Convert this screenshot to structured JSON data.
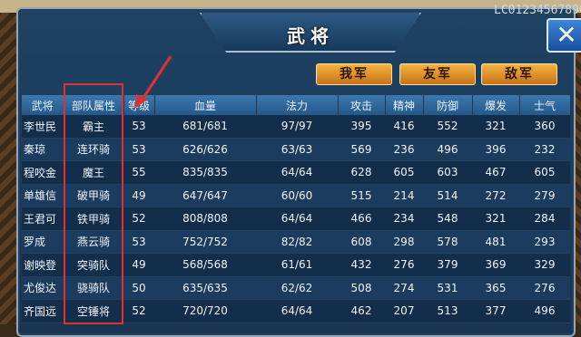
{
  "window": {
    "title": "武将",
    "id_text": "LC01234567890",
    "close_label": "✕"
  },
  "tabs": [
    {
      "label": "我军"
    },
    {
      "label": "友军"
    },
    {
      "label": "敌军"
    }
  ],
  "table": {
    "headers": [
      "武将",
      "部队属性",
      "等级",
      "血量",
      "法力",
      "攻击",
      "精神",
      "防御",
      "爆发",
      "士气"
    ],
    "rows": [
      [
        "李世民",
        "霸主",
        "53",
        "681/681",
        "97/97",
        "395",
        "416",
        "552",
        "321",
        "360"
      ],
      [
        "秦琼",
        "连环骑",
        "53",
        "626/626",
        "63/63",
        "569",
        "236",
        "496",
        "396",
        "232"
      ],
      [
        "程咬金",
        "魔王",
        "55",
        "835/835",
        "64/64",
        "628",
        "605",
        "603",
        "467",
        "605"
      ],
      [
        "单雄信",
        "破甲骑",
        "49",
        "647/647",
        "60/60",
        "515",
        "214",
        "514",
        "272",
        "279"
      ],
      [
        "王君可",
        "铁甲骑",
        "52",
        "808/808",
        "64/64",
        "466",
        "234",
        "548",
        "321",
        "284"
      ],
      [
        "罗成",
        "燕云骑",
        "53",
        "752/752",
        "82/82",
        "608",
        "298",
        "578",
        "481",
        "293"
      ],
      [
        "谢映登",
        "突骑队",
        "49",
        "568/568",
        "61/61",
        "432",
        "276",
        "379",
        "369",
        "329"
      ],
      [
        "尤俊达",
        "骁骑队",
        "50",
        "635/635",
        "62/62",
        "508",
        "274",
        "531",
        "365",
        "276"
      ],
      [
        "齐国远",
        "空锤将",
        "52",
        "720/720",
        "64/64",
        "462",
        "207",
        "513",
        "377",
        "496"
      ]
    ]
  },
  "colors": {
    "annotation": "#e03030",
    "tab_gradient_top": "#f4b33e",
    "panel": "#1f4263"
  }
}
